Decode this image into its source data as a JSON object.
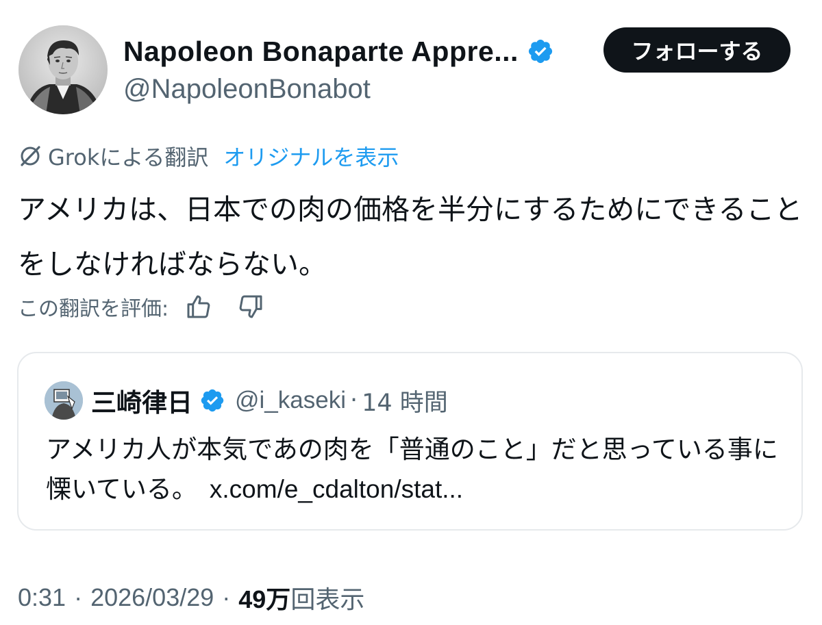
{
  "author": {
    "display_name": "Napoleon Bonaparte Appre...",
    "handle": "@NapoleonBonabot",
    "verified": true
  },
  "follow_button": {
    "label": "フォローする"
  },
  "translation": {
    "grok_label": "Grokによる翻訳",
    "show_original_label": "オリジナルを表示"
  },
  "tweet": {
    "text": "アメリカは、日本での肉の価格を半分にするためにできることをしなければならない。"
  },
  "rate_translation": {
    "label": "この翻訳を評価:"
  },
  "quote": {
    "display_name": "三崎律日",
    "handle": "@i_kaseki",
    "separator": "·",
    "time": "14 時間",
    "text": "アメリカ人が本気であの肉を「普通のこと」だと思っている事に慄いている。",
    "link": "x.com/e_cdalton/stat..."
  },
  "meta": {
    "time": "0:31",
    "date": "2026/03/29",
    "separator": "·",
    "views_count": "49万",
    "views_label": "回表示"
  },
  "colors": {
    "text_primary": "#0f1419",
    "text_secondary": "#536471",
    "link_blue": "#1d9bf0",
    "verified_blue": "#1d9bf0",
    "border": "#e6e9ec"
  }
}
